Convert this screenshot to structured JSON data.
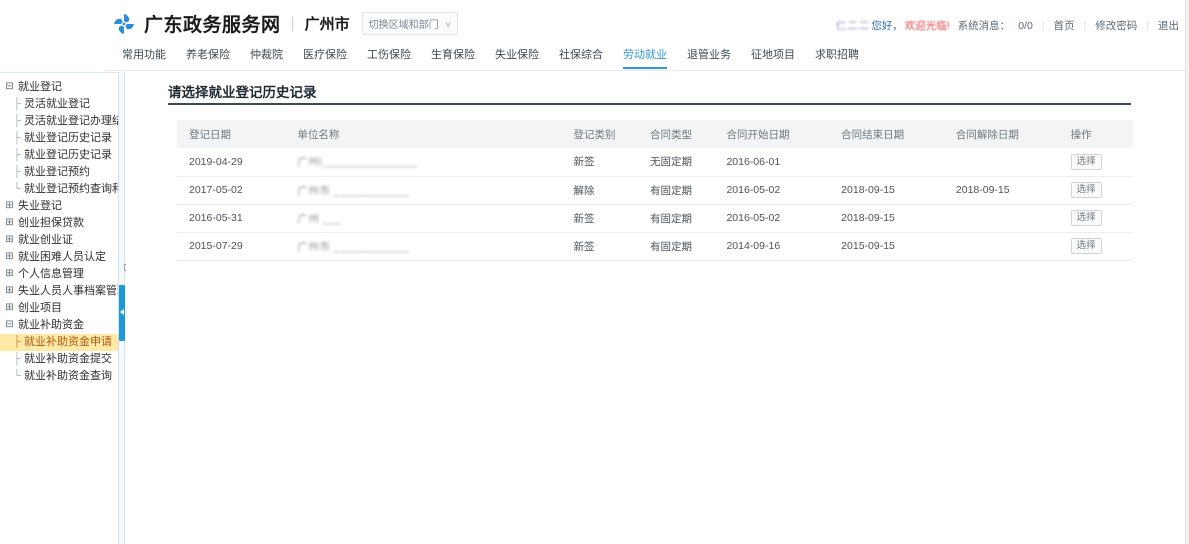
{
  "header": {
    "logo_icon": "pinwheel-logo-icon",
    "brand_name": "广东政务服务网",
    "separator": "|",
    "city": "广州市",
    "region_switch_label": "切换区域和部门",
    "region_switch_caret": "˅",
    "user": {
      "name_masked": "仁二二",
      "greeting": "您好，",
      "welcome": "欢迎光临!",
      "system_message_label": "系统消息：",
      "system_message_value": "0/0",
      "divider": "|",
      "home_link": "首页",
      "change_password_link": "修改密码",
      "logout_link": "退出"
    },
    "nav": [
      {
        "label": "常用功能",
        "active": false
      },
      {
        "label": "养老保险",
        "active": false
      },
      {
        "label": "仲裁院",
        "active": false
      },
      {
        "label": "医疗保险",
        "active": false
      },
      {
        "label": "工伤保险",
        "active": false
      },
      {
        "label": "生育保险",
        "active": false
      },
      {
        "label": "失业保险",
        "active": false
      },
      {
        "label": "社保综合",
        "active": false
      },
      {
        "label": "劳动就业",
        "active": true
      },
      {
        "label": "退管业务",
        "active": false
      },
      {
        "label": "征地项目",
        "active": false
      },
      {
        "label": "求职招聘",
        "active": false
      }
    ],
    "accent_color": "#2f9ad6"
  },
  "sidebar": {
    "expand_icon": "plus-box-icon",
    "collapse_icon": "minus-box-icon",
    "items": [
      {
        "label": "就业登记",
        "toggle": "⊟",
        "level": 0
      },
      {
        "label": "灵活就业登记",
        "branch": "├",
        "level": 1
      },
      {
        "label": "灵活就业登记办理结果查",
        "branch": "├",
        "level": 1
      },
      {
        "label": "就业登记历史记录",
        "branch": "├",
        "level": 1
      },
      {
        "label": "就业登记历史记录",
        "branch": "├",
        "level": 1
      },
      {
        "label": "就业登记预约",
        "branch": "├",
        "level": 1
      },
      {
        "label": "就业登记预约查询和取消",
        "branch": "└",
        "level": 1
      },
      {
        "label": "失业登记",
        "toggle": "⊞",
        "level": 0
      },
      {
        "label": "创业担保贷款",
        "toggle": "⊞",
        "level": 0
      },
      {
        "label": "就业创业证",
        "toggle": "⊞",
        "level": 0
      },
      {
        "label": "就业困难人员认定",
        "toggle": "⊞",
        "level": 0
      },
      {
        "label": "个人信息管理",
        "toggle": "⊞",
        "level": 0
      },
      {
        "label": "失业人员人事档案管理",
        "toggle": "⊞",
        "level": 0
      },
      {
        "label": "创业项目",
        "toggle": "⊞",
        "level": 0
      },
      {
        "label": "就业补助资金",
        "toggle": "⊟",
        "level": 0
      },
      {
        "label": "就业补助资金申请",
        "branch": "├",
        "level": 1,
        "active": true
      },
      {
        "label": "就业补助资金提交",
        "branch": "├",
        "level": 1
      },
      {
        "label": "就业补助资金查询",
        "branch": "└",
        "level": 1
      }
    ],
    "highlight_bg": "#ffe9a6",
    "highlight_fg": "#b25a12",
    "splitter_color": "#1b9ad6"
  },
  "main": {
    "panel_title": "请选择就业登记历史记录",
    "table": {
      "columns": [
        "登记日期",
        "单位名称",
        "登记类别",
        "合同类型",
        "合同开始日期",
        "合同结束日期",
        "合同解除日期",
        "操作"
      ],
      "action_label": "选择",
      "rows": [
        {
          "reg_date": "2019-04-29",
          "unit_name": "广州l_______________",
          "reg_category": "新签",
          "contract_type": "无固定期",
          "start_date": "2016-06-01",
          "end_date": "",
          "terminate_date": "",
          "action": "选择"
        },
        {
          "reg_date": "2017-05-02",
          "unit_name": "广州市 ____________",
          "reg_category": "解除",
          "contract_type": "有固定期",
          "start_date": "2016-05-02",
          "end_date": "2018-09-15",
          "terminate_date": "2018-09-15",
          "action": "选择"
        },
        {
          "reg_date": "2016-05-31",
          "unit_name": "广州 ___",
          "reg_category": "新签",
          "contract_type": "有固定期",
          "start_date": "2016-05-02",
          "end_date": "2018-09-15",
          "terminate_date": "",
          "action": "选择"
        },
        {
          "reg_date": "2015-07-29",
          "unit_name": "广州市 ____________",
          "reg_category": "新签",
          "contract_type": "有固定期",
          "start_date": "2014-09-16",
          "end_date": "2015-09-15",
          "terminate_date": "",
          "action": "选择"
        }
      ]
    }
  }
}
